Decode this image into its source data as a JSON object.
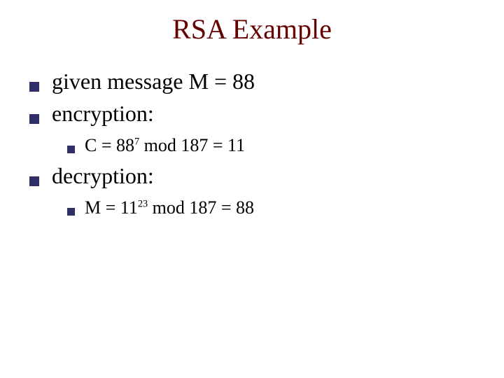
{
  "title": "RSA Example",
  "lines": {
    "l1": "given message M = 88",
    "l2": "encryption:",
    "l3_pre": "C = 88",
    "l3_sup": "7",
    "l3_post": " mod 187 = 11",
    "l4": "decryption:",
    "l5_pre": "M = 11",
    "l5_sup": "23",
    "l5_post": " mod 187 = 88"
  }
}
